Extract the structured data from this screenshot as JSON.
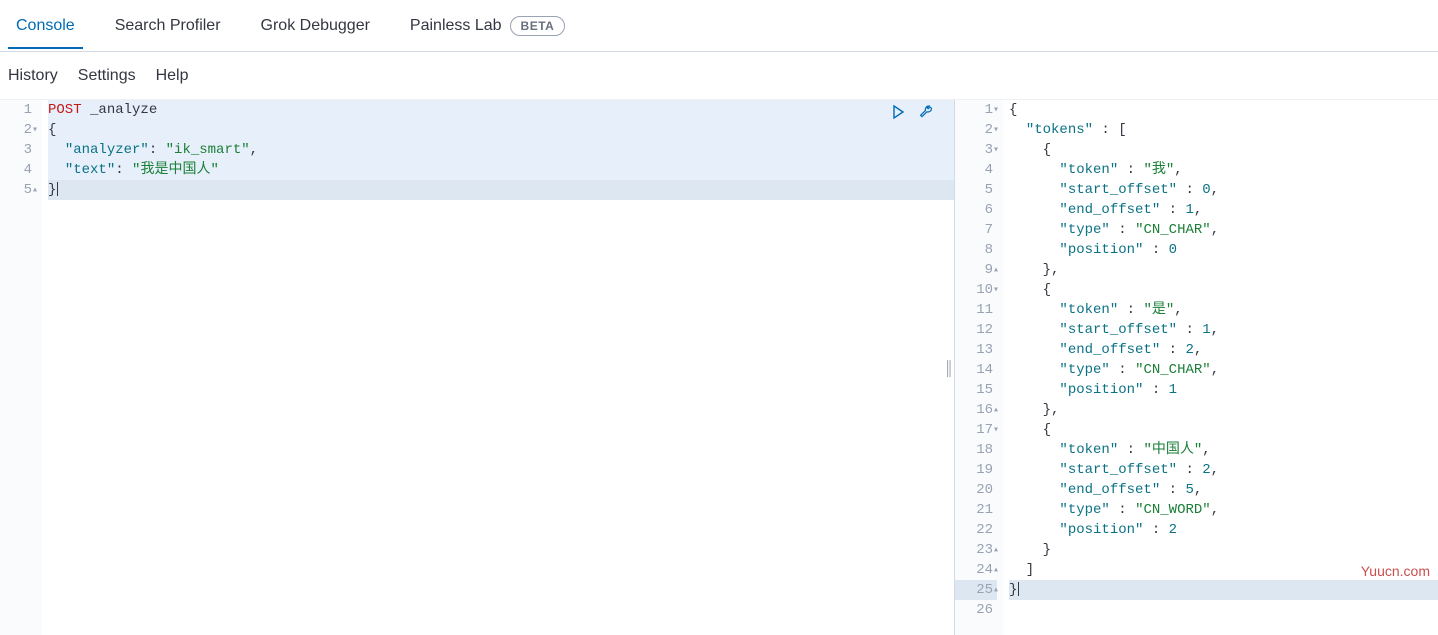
{
  "tabs": {
    "items": [
      {
        "label": "Console",
        "active": true
      },
      {
        "label": "Search Profiler",
        "active": false
      },
      {
        "label": "Grok Debugger",
        "active": false
      },
      {
        "label": "Painless Lab",
        "active": false,
        "badge": "BETA"
      }
    ]
  },
  "subtabs": {
    "items": [
      {
        "label": "History"
      },
      {
        "label": "Settings"
      },
      {
        "label": "Help"
      }
    ]
  },
  "actions": {
    "run": "run-icon",
    "wrench": "wrench-icon"
  },
  "request": {
    "lines": [
      {
        "n": "1",
        "fold": "",
        "tokens": [
          {
            "t": "POST",
            "c": "post"
          },
          {
            "t": " _analyze",
            "c": ""
          }
        ]
      },
      {
        "n": "2",
        "fold": "▾",
        "tokens": [
          {
            "t": "{",
            "c": "punc"
          }
        ]
      },
      {
        "n": "3",
        "fold": "",
        "tokens": [
          {
            "t": "  ",
            "c": ""
          },
          {
            "t": "\"analyzer\"",
            "c": "kw"
          },
          {
            "t": ": ",
            "c": "punc"
          },
          {
            "t": "\"ik_smart\"",
            "c": "strg"
          },
          {
            "t": ",",
            "c": "punc"
          }
        ]
      },
      {
        "n": "4",
        "fold": "",
        "tokens": [
          {
            "t": "  ",
            "c": ""
          },
          {
            "t": "\"text\"",
            "c": "kw"
          },
          {
            "t": ": ",
            "c": "punc"
          },
          {
            "t": "\"我是中国人\"",
            "c": "strg"
          }
        ]
      },
      {
        "n": "5",
        "fold": "▴",
        "tokens": [
          {
            "t": "}",
            "c": "punc"
          }
        ],
        "cursor": true
      }
    ]
  },
  "response": {
    "lines": [
      {
        "n": "1",
        "fold": "▾",
        "tokens": [
          {
            "t": "{",
            "c": "punc"
          }
        ]
      },
      {
        "n": "2",
        "fold": "▾",
        "tokens": [
          {
            "t": "  ",
            "c": ""
          },
          {
            "t": "\"tokens\"",
            "c": "kw"
          },
          {
            "t": " : [",
            "c": "punc"
          }
        ]
      },
      {
        "n": "3",
        "fold": "▾",
        "tokens": [
          {
            "t": "    {",
            "c": "punc"
          }
        ]
      },
      {
        "n": "4",
        "fold": "",
        "tokens": [
          {
            "t": "      ",
            "c": ""
          },
          {
            "t": "\"token\"",
            "c": "kw"
          },
          {
            "t": " : ",
            "c": "punc"
          },
          {
            "t": "\"我\"",
            "c": "strg"
          },
          {
            "t": ",",
            "c": "punc"
          }
        ]
      },
      {
        "n": "5",
        "fold": "",
        "tokens": [
          {
            "t": "      ",
            "c": ""
          },
          {
            "t": "\"start_offset\"",
            "c": "kw"
          },
          {
            "t": " : ",
            "c": "punc"
          },
          {
            "t": "0",
            "c": "num"
          },
          {
            "t": ",",
            "c": "punc"
          }
        ]
      },
      {
        "n": "6",
        "fold": "",
        "tokens": [
          {
            "t": "      ",
            "c": ""
          },
          {
            "t": "\"end_offset\"",
            "c": "kw"
          },
          {
            "t": " : ",
            "c": "punc"
          },
          {
            "t": "1",
            "c": "num"
          },
          {
            "t": ",",
            "c": "punc"
          }
        ]
      },
      {
        "n": "7",
        "fold": "",
        "tokens": [
          {
            "t": "      ",
            "c": ""
          },
          {
            "t": "\"type\"",
            "c": "kw"
          },
          {
            "t": " : ",
            "c": "punc"
          },
          {
            "t": "\"CN_CHAR\"",
            "c": "strg"
          },
          {
            "t": ",",
            "c": "punc"
          }
        ]
      },
      {
        "n": "8",
        "fold": "",
        "tokens": [
          {
            "t": "      ",
            "c": ""
          },
          {
            "t": "\"position\"",
            "c": "kw"
          },
          {
            "t": " : ",
            "c": "punc"
          },
          {
            "t": "0",
            "c": "num"
          }
        ]
      },
      {
        "n": "9",
        "fold": "▴",
        "tokens": [
          {
            "t": "    },",
            "c": "punc"
          }
        ]
      },
      {
        "n": "10",
        "fold": "▾",
        "tokens": [
          {
            "t": "    {",
            "c": "punc"
          }
        ]
      },
      {
        "n": "11",
        "fold": "",
        "tokens": [
          {
            "t": "      ",
            "c": ""
          },
          {
            "t": "\"token\"",
            "c": "kw"
          },
          {
            "t": " : ",
            "c": "punc"
          },
          {
            "t": "\"是\"",
            "c": "strg"
          },
          {
            "t": ",",
            "c": "punc"
          }
        ]
      },
      {
        "n": "12",
        "fold": "",
        "tokens": [
          {
            "t": "      ",
            "c": ""
          },
          {
            "t": "\"start_offset\"",
            "c": "kw"
          },
          {
            "t": " : ",
            "c": "punc"
          },
          {
            "t": "1",
            "c": "num"
          },
          {
            "t": ",",
            "c": "punc"
          }
        ]
      },
      {
        "n": "13",
        "fold": "",
        "tokens": [
          {
            "t": "      ",
            "c": ""
          },
          {
            "t": "\"end_offset\"",
            "c": "kw"
          },
          {
            "t": " : ",
            "c": "punc"
          },
          {
            "t": "2",
            "c": "num"
          },
          {
            "t": ",",
            "c": "punc"
          }
        ]
      },
      {
        "n": "14",
        "fold": "",
        "tokens": [
          {
            "t": "      ",
            "c": ""
          },
          {
            "t": "\"type\"",
            "c": "kw"
          },
          {
            "t": " : ",
            "c": "punc"
          },
          {
            "t": "\"CN_CHAR\"",
            "c": "strg"
          },
          {
            "t": ",",
            "c": "punc"
          }
        ]
      },
      {
        "n": "15",
        "fold": "",
        "tokens": [
          {
            "t": "      ",
            "c": ""
          },
          {
            "t": "\"position\"",
            "c": "kw"
          },
          {
            "t": " : ",
            "c": "punc"
          },
          {
            "t": "1",
            "c": "num"
          }
        ]
      },
      {
        "n": "16",
        "fold": "▴",
        "tokens": [
          {
            "t": "    },",
            "c": "punc"
          }
        ]
      },
      {
        "n": "17",
        "fold": "▾",
        "tokens": [
          {
            "t": "    {",
            "c": "punc"
          }
        ]
      },
      {
        "n": "18",
        "fold": "",
        "tokens": [
          {
            "t": "      ",
            "c": ""
          },
          {
            "t": "\"token\"",
            "c": "kw"
          },
          {
            "t": " : ",
            "c": "punc"
          },
          {
            "t": "\"中国人\"",
            "c": "strg"
          },
          {
            "t": ",",
            "c": "punc"
          }
        ]
      },
      {
        "n": "19",
        "fold": "",
        "tokens": [
          {
            "t": "      ",
            "c": ""
          },
          {
            "t": "\"start_offset\"",
            "c": "kw"
          },
          {
            "t": " : ",
            "c": "punc"
          },
          {
            "t": "2",
            "c": "num"
          },
          {
            "t": ",",
            "c": "punc"
          }
        ]
      },
      {
        "n": "20",
        "fold": "",
        "tokens": [
          {
            "t": "      ",
            "c": ""
          },
          {
            "t": "\"end_offset\"",
            "c": "kw"
          },
          {
            "t": " : ",
            "c": "punc"
          },
          {
            "t": "5",
            "c": "num"
          },
          {
            "t": ",",
            "c": "punc"
          }
        ]
      },
      {
        "n": "21",
        "fold": "",
        "tokens": [
          {
            "t": "      ",
            "c": ""
          },
          {
            "t": "\"type\"",
            "c": "kw"
          },
          {
            "t": " : ",
            "c": "punc"
          },
          {
            "t": "\"CN_WORD\"",
            "c": "strg"
          },
          {
            "t": ",",
            "c": "punc"
          }
        ]
      },
      {
        "n": "22",
        "fold": "",
        "tokens": [
          {
            "t": "      ",
            "c": ""
          },
          {
            "t": "\"position\"",
            "c": "kw"
          },
          {
            "t": " : ",
            "c": "punc"
          },
          {
            "t": "2",
            "c": "num"
          }
        ]
      },
      {
        "n": "23",
        "fold": "▴",
        "tokens": [
          {
            "t": "    }",
            "c": "punc"
          }
        ]
      },
      {
        "n": "24",
        "fold": "▴",
        "tokens": [
          {
            "t": "  ]",
            "c": "punc"
          }
        ]
      },
      {
        "n": "25",
        "fold": "▴",
        "tokens": [
          {
            "t": "}",
            "c": "punc"
          }
        ],
        "hl": true,
        "cursor": true
      },
      {
        "n": "26",
        "fold": "",
        "tokens": [
          {
            "t": "",
            "c": ""
          }
        ]
      }
    ]
  },
  "watermark": "Yuucn.com"
}
